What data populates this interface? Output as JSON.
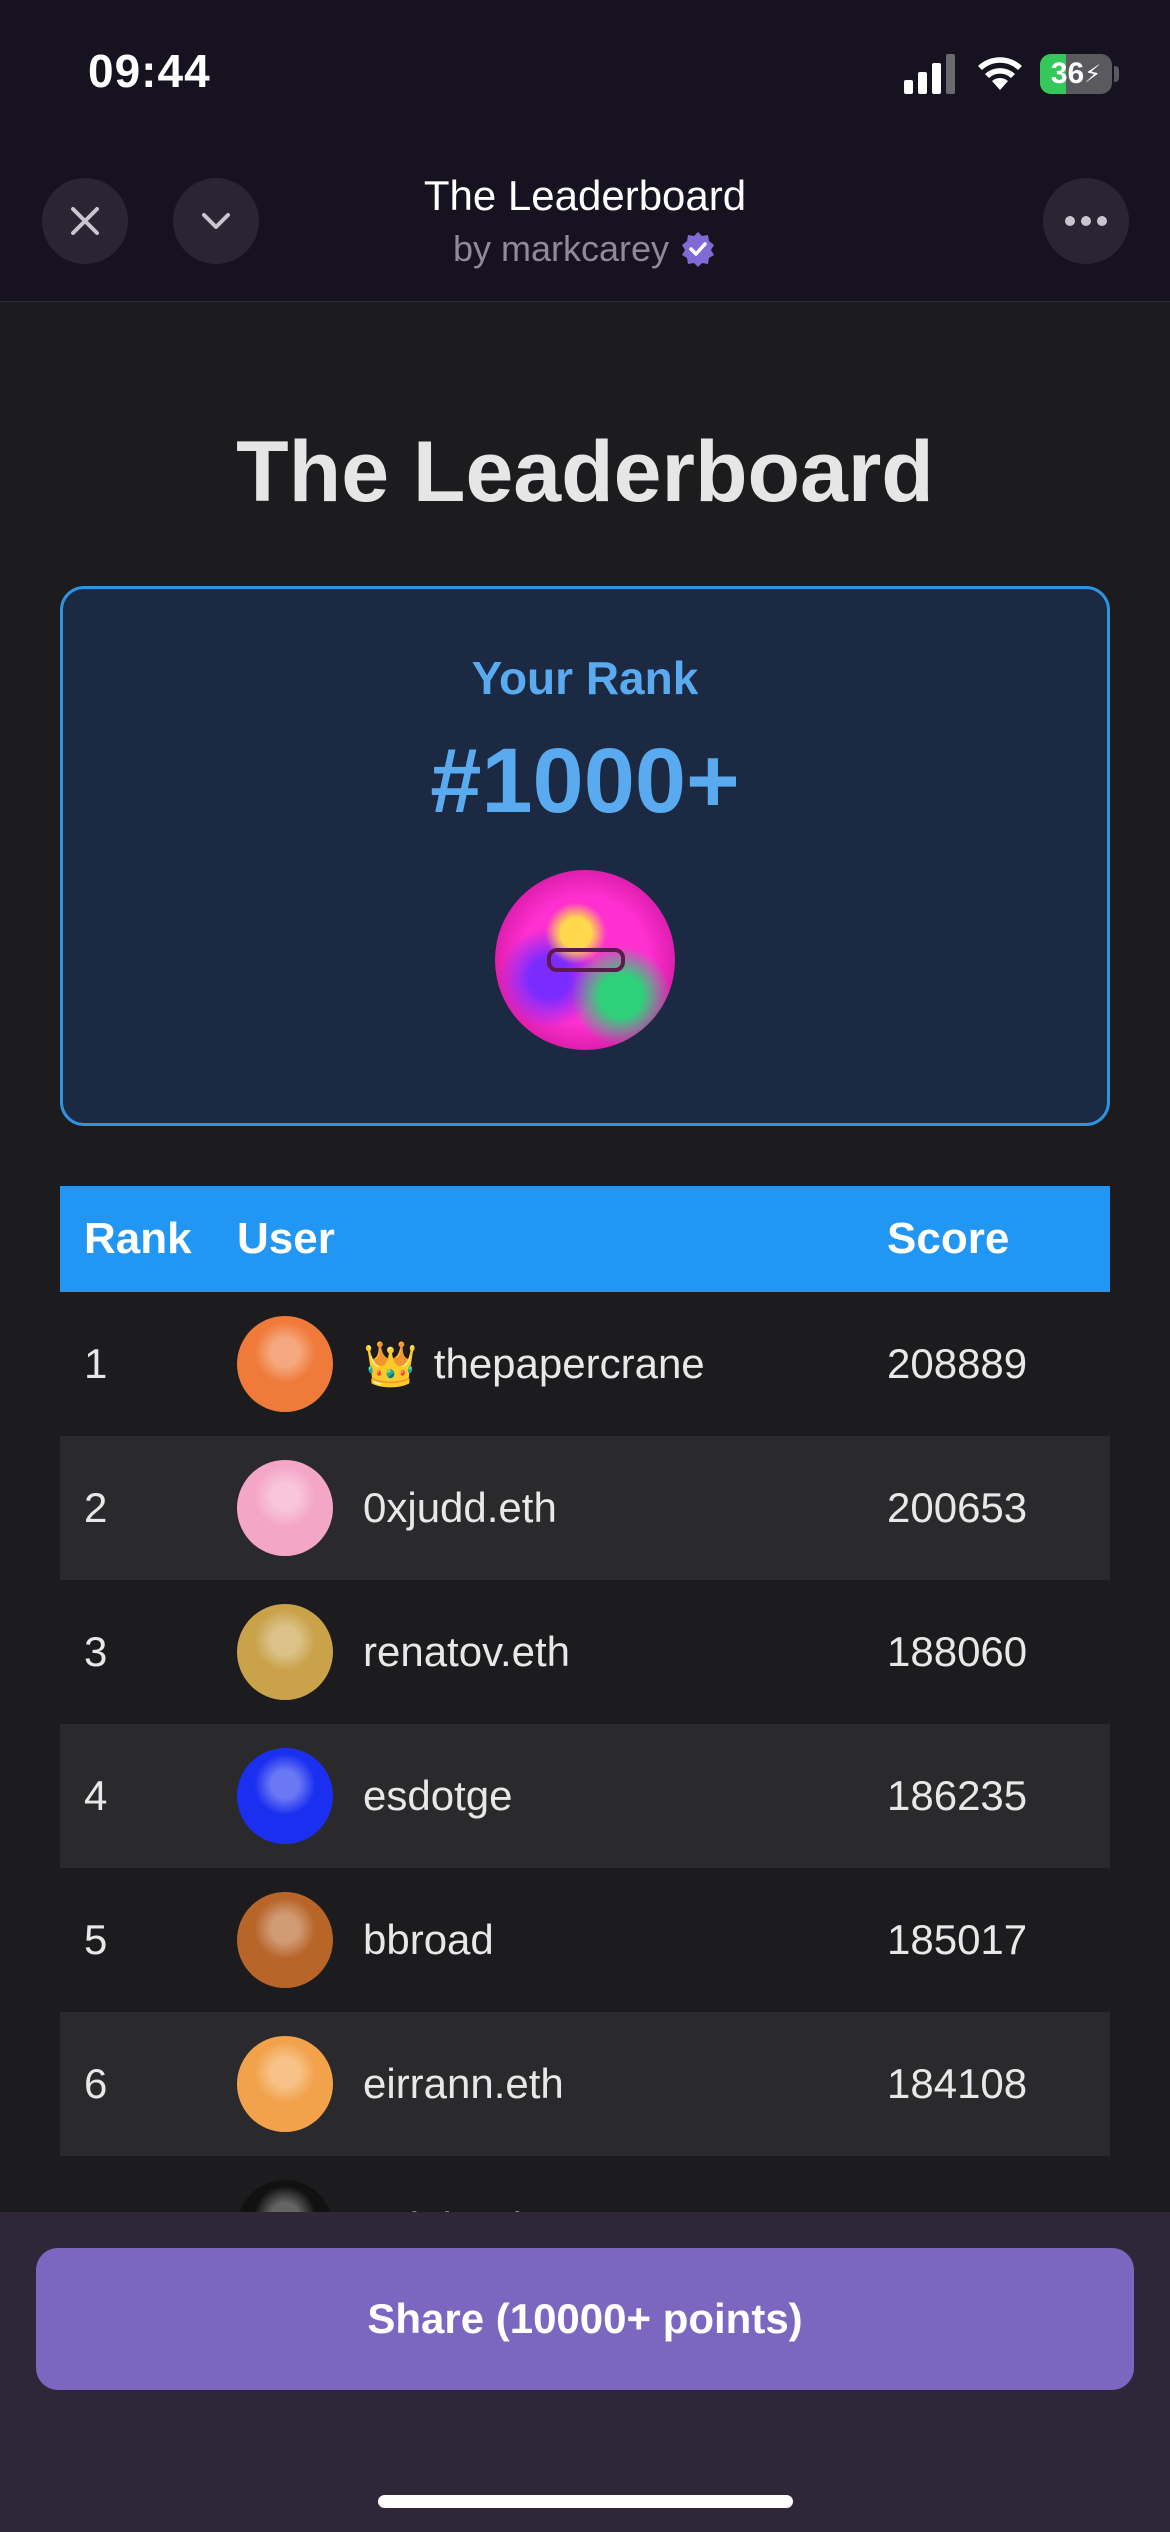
{
  "status_bar": {
    "time": "09:44",
    "battery": "36",
    "battery_fill_percent": 36
  },
  "header": {
    "title": "The Leaderboard",
    "by_label": "by markcarey",
    "close_icon": "close-icon",
    "collapse_icon": "chevron-down-icon",
    "more_icon": "more-icon"
  },
  "page": {
    "title": "The Leaderboard"
  },
  "your_rank": {
    "label": "Your Rank",
    "value": "#1000+"
  },
  "table": {
    "headers": {
      "rank": "Rank",
      "user": "User",
      "score": "Score"
    },
    "rows": [
      {
        "rank": "1",
        "user": "thepapercrane",
        "score": "208889",
        "crown": "👑",
        "avatar_color": "#f07a3a"
      },
      {
        "rank": "2",
        "user": "0xjudd.eth",
        "score": "200653",
        "crown": "",
        "avatar_color": "#f4a6c6"
      },
      {
        "rank": "3",
        "user": "renatov.eth",
        "score": "188060",
        "crown": "",
        "avatar_color": "#c9a24a"
      },
      {
        "rank": "4",
        "user": "esdotge",
        "score": "186235",
        "crown": "",
        "avatar_color": "#1b2ff0"
      },
      {
        "rank": "5",
        "user": "bbroad",
        "score": "185017",
        "crown": "",
        "avatar_color": "#b8652a"
      },
      {
        "rank": "6",
        "user": "eirrann.eth",
        "score": "184108",
        "crown": "",
        "avatar_color": "#f2a24a"
      },
      {
        "rank": "7",
        "user": "77lab.eth",
        "score": "183747",
        "crown": "",
        "avatar_color": "#111111"
      }
    ]
  },
  "share_button": {
    "label": "Share (10000+ points)"
  },
  "colors": {
    "accent": "#2196f3",
    "rank_text": "#5aaaf0",
    "share": "#7b66c0"
  }
}
